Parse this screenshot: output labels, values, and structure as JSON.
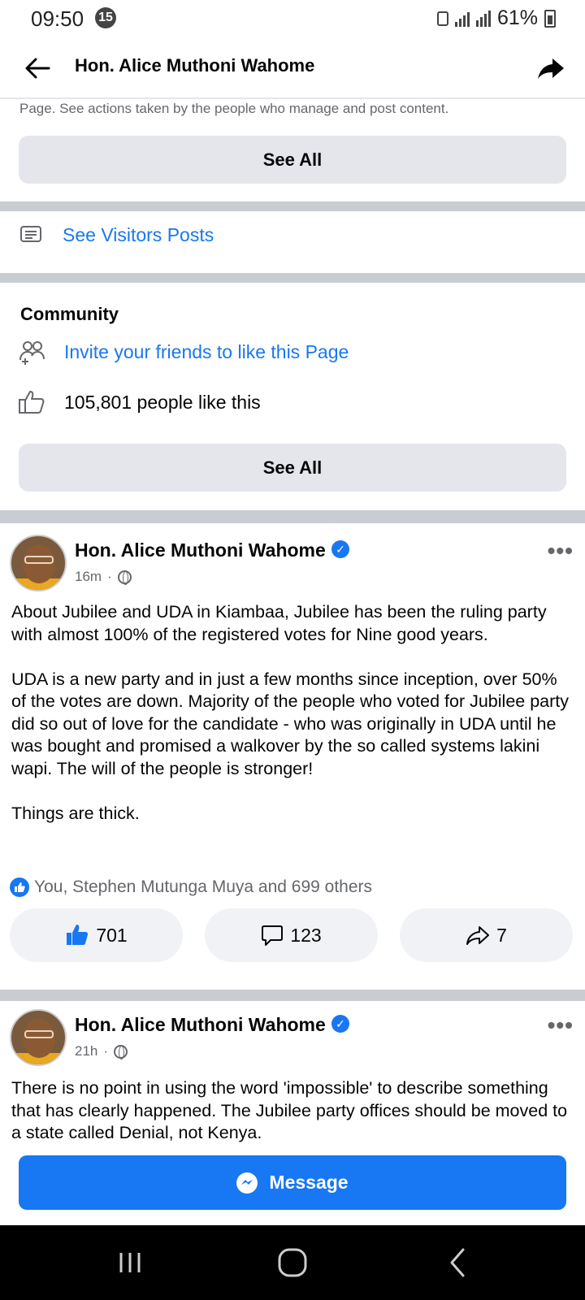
{
  "status_bar": {
    "time": "09:50",
    "notification_count": "15",
    "battery": "61%"
  },
  "header": {
    "title": "Hon. Alice Muthoni Wahome"
  },
  "transparency": {
    "text": "Page. See actions taken by the people who manage and post content.",
    "see_all_label": "See All"
  },
  "visitors": {
    "label": "See Visitors Posts"
  },
  "community": {
    "title": "Community",
    "invite_label": "Invite your friends to like this Page",
    "likes_text": "105,801 people like this",
    "see_all_label": "See All"
  },
  "posts": [
    {
      "author": "Hon. Alice Muthoni Wahome",
      "time": "16m",
      "separator": "·",
      "text": "About Jubilee and UDA in Kiambaa, Jubilee has been the ruling party with almost 100% of the registered votes for Nine good years.\n\nUDA is a new party and in just a few months since inception, over 50% of the votes are down. Majority of the people who voted for Jubilee party did so out of love for the candidate - who was originally in UDA until he was bought and promised a walkover by the so called systems lakini wapi. The will of the people is stronger!\n\nThings are thick.",
      "reactions_text": "You, Stephen Mutunga Muya and 699 others",
      "like_count": "701",
      "comment_count": "123",
      "share_count": "7"
    },
    {
      "author": "Hon. Alice Muthoni Wahome",
      "time": "21h",
      "separator": "·",
      "text": "There is no point in using the word 'impossible' to describe something that has clearly happened. The Jubilee party offices should be moved to a state called Denial, not Kenya."
    }
  ],
  "message_button": {
    "label": "Message"
  },
  "colors": {
    "brand_blue": "#1877f2",
    "divider_gray": "#c9ccd1",
    "button_gray": "#e4e6eb",
    "secondary_text": "#65676b"
  },
  "icons": {
    "back": "arrow-left-icon",
    "share": "share-arrow-icon",
    "visitors": "document-lines-icon",
    "invite": "people-plus-icon",
    "likes": "thumbs-up-outline-icon",
    "verified": "verified-check-icon",
    "more": "more-horizontal-icon",
    "globe": "globe-icon",
    "like": "thumbs-up-filled-icon",
    "comment": "speech-bubble-icon",
    "share_post": "share-outline-icon",
    "messenger": "messenger-icon"
  }
}
